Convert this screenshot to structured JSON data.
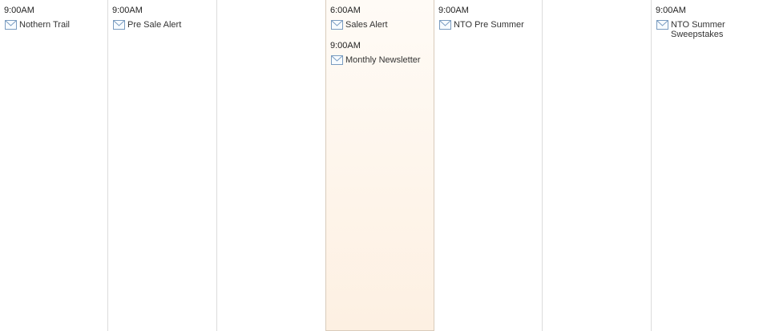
{
  "days": [
    {
      "today": false,
      "events": [
        {
          "time": "9:00AM",
          "title": "Nothern Trail",
          "icon": "email-icon"
        }
      ]
    },
    {
      "today": false,
      "events": [
        {
          "time": "9:00AM",
          "title": "Pre Sale Alert",
          "icon": "email-icon"
        }
      ]
    },
    {
      "today": false,
      "events": []
    },
    {
      "today": true,
      "events": [
        {
          "time": "6:00AM",
          "title": "Sales Alert",
          "icon": "email-icon"
        },
        {
          "time": "9:00AM",
          "title": "Monthly Newsletter",
          "icon": "email-icon"
        }
      ]
    },
    {
      "today": false,
      "events": [
        {
          "time": "9:00AM",
          "title": "NTO Pre Summer",
          "icon": "email-icon"
        }
      ]
    },
    {
      "today": false,
      "events": []
    },
    {
      "today": false,
      "events": [
        {
          "time": "9:00AM",
          "title": "NTO Summer Sweepstakes",
          "icon": "email-icon"
        }
      ]
    }
  ],
  "colors": {
    "today_bg_top": "#fffbf6",
    "today_bg_bottom": "#fdf0e2",
    "divider": "#dcdcdc",
    "icon_stroke": "#7a9cc0"
  }
}
